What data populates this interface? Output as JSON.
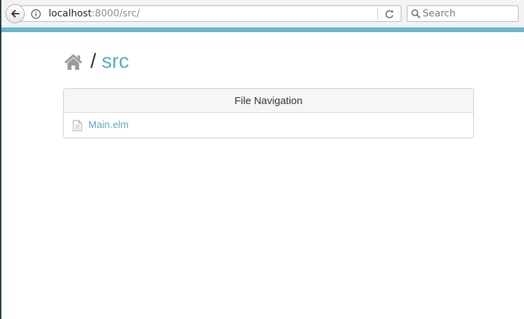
{
  "browser": {
    "url_host": "localhost",
    "url_path": ":8000/src/",
    "search_placeholder": "Search",
    "accent_color": "#6cb7cb"
  },
  "breadcrumb": {
    "home_icon": "home-icon",
    "separator": "/",
    "current": "src"
  },
  "panel": {
    "title": "File Navigation",
    "files": [
      {
        "name": "Main.elm",
        "icon": "file-icon"
      }
    ]
  },
  "colors": {
    "link": "#5aacc4",
    "icon_gray": "#999999"
  }
}
